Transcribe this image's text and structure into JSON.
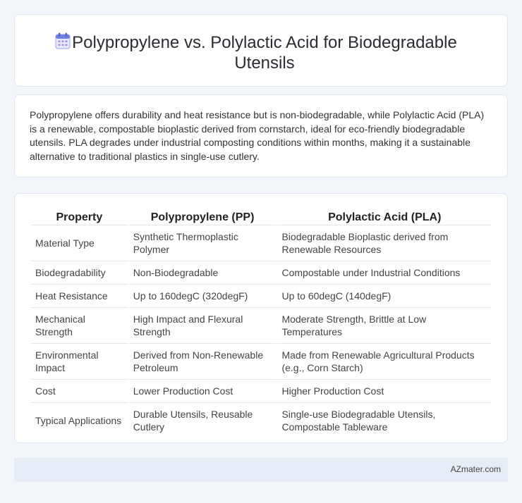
{
  "header": {
    "icon": "calendar-icon",
    "title": "Polypropylene vs. Polylactic Acid for Biodegradable Utensils"
  },
  "summary": {
    "text": "Polypropylene offers durability and heat resistance but is non-biodegradable, while Polylactic Acid (PLA) is a renewable, compostable bioplastic derived from cornstarch, ideal for eco-friendly biodegradable utensils. PLA degrades under industrial composting conditions within months, making it a sustainable alternative to traditional plastics in single-use cutlery."
  },
  "table": {
    "headers": [
      "Property",
      "Polypropylene (PP)",
      "Polylactic Acid (PLA)"
    ],
    "rows": [
      [
        "Material Type",
        "Synthetic Thermoplastic Polymer",
        "Biodegradable Bioplastic derived from Renewable Resources"
      ],
      [
        "Biodegradability",
        "Non-Biodegradable",
        "Compostable under Industrial Conditions"
      ],
      [
        "Heat Resistance",
        "Up to 160degC (320degF)",
        "Up to 60degC (140degF)"
      ],
      [
        "Mechanical Strength",
        "High Impact and Flexural Strength",
        "Moderate Strength, Brittle at Low Temperatures"
      ],
      [
        "Environmental Impact",
        "Derived from Non-Renewable Petroleum",
        "Made from Renewable Agricultural Products (e.g., Corn Starch)"
      ],
      [
        "Cost",
        "Lower Production Cost",
        "Higher Production Cost"
      ],
      [
        "Typical Applications",
        "Durable Utensils, Reusable Cutlery",
        "Single-use Biodegradable Utensils, Compostable Tableware"
      ]
    ]
  },
  "footer": {
    "brand": "AZmater.com"
  }
}
